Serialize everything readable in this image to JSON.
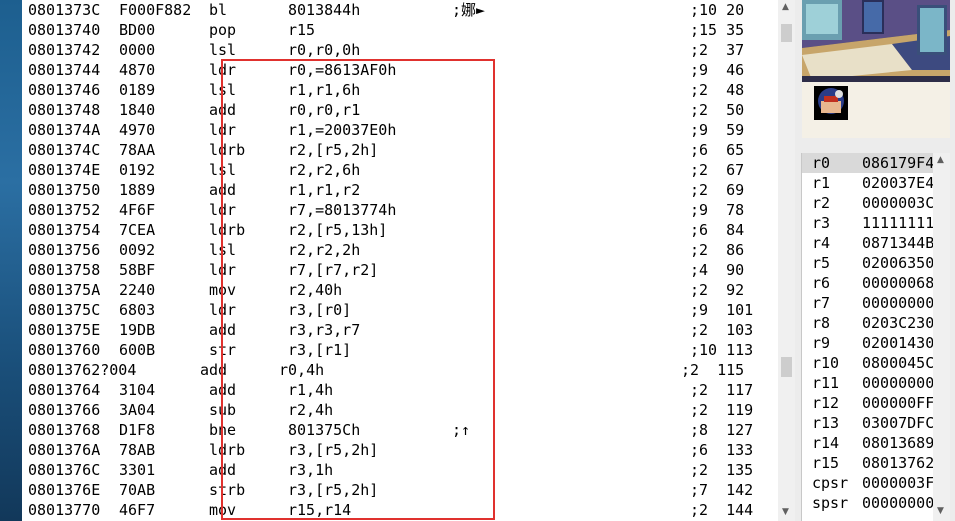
{
  "disassembly": {
    "rows": [
      {
        "addr": "0801373C",
        "op": "F000F882",
        "mn": "bl",
        "args": "8013844h",
        "cmt": ";娜►",
        "cyc": ";10 20"
      },
      {
        "addr": "08013740",
        "op": "BD00",
        "mn": "pop",
        "args": "r15",
        "cmt": "",
        "cyc": ";15 35"
      },
      {
        "addr": "08013742",
        "op": "0000",
        "mn": "lsl",
        "args": "r0,r0,0h",
        "cmt": "",
        "cyc": ";2  37"
      },
      {
        "addr": "08013744",
        "op": "4870",
        "mn": "ldr",
        "args": "r0,=8613AF0h",
        "cmt": "",
        "cyc": ";9  46"
      },
      {
        "addr": "08013746",
        "op": "0189",
        "mn": "lsl",
        "args": "r1,r1,6h",
        "cmt": "",
        "cyc": ";2  48"
      },
      {
        "addr": "08013748",
        "op": "1840",
        "mn": "add",
        "args": "r0,r0,r1",
        "cmt": "",
        "cyc": ";2  50"
      },
      {
        "addr": "0801374A",
        "op": "4970",
        "mn": "ldr",
        "args": "r1,=20037E0h",
        "cmt": "",
        "cyc": ";9  59"
      },
      {
        "addr": "0801374C",
        "op": "78AA",
        "mn": "ldrb",
        "args": "r2,[r5,2h]",
        "cmt": "",
        "cyc": ";6  65"
      },
      {
        "addr": "0801374E",
        "op": "0192",
        "mn": "lsl",
        "args": "r2,r2,6h",
        "cmt": "",
        "cyc": ";2  67"
      },
      {
        "addr": "08013750",
        "op": "1889",
        "mn": "add",
        "args": "r1,r1,r2",
        "cmt": "",
        "cyc": ";2  69"
      },
      {
        "addr": "08013752",
        "op": "4F6F",
        "mn": "ldr",
        "args": "r7,=8013774h",
        "cmt": "",
        "cyc": ";9  78"
      },
      {
        "addr": "08013754",
        "op": "7CEA",
        "mn": "ldrb",
        "args": "r2,[r5,13h]",
        "cmt": "",
        "cyc": ";6  84"
      },
      {
        "addr": "08013756",
        "op": "0092",
        "mn": "lsl",
        "args": "r2,r2,2h",
        "cmt": "",
        "cyc": ";2  86"
      },
      {
        "addr": "08013758",
        "op": "58BF",
        "mn": "ldr",
        "args": "r7,[r7,r2]",
        "cmt": "",
        "cyc": ";4  90"
      },
      {
        "addr": "0801375A",
        "op": "2240",
        "mn": "mov",
        "args": "r2,40h",
        "cmt": "",
        "cyc": ";2  92"
      },
      {
        "addr": "0801375C",
        "op": "6803",
        "mn": "ldr",
        "args": "r3,[r0]",
        "cmt": "",
        "cyc": ";9  101"
      },
      {
        "addr": "0801375E",
        "op": "19DB",
        "mn": "add",
        "args": "r3,r3,r7",
        "cmt": "",
        "cyc": ";2  103"
      },
      {
        "addr": "08013760",
        "op": "600B",
        "mn": "str",
        "args": "r3,[r1]",
        "cmt": "",
        "cyc": ";10 113"
      },
      {
        "addr": "08013762?004",
        "op": "",
        "mn": "add",
        "args": "r0,4h",
        "cmt": "",
        "cyc": ";2  115",
        "shift": true
      },
      {
        "addr": "08013764",
        "op": "3104",
        "mn": "add",
        "args": "r1,4h",
        "cmt": "",
        "cyc": ";2  117"
      },
      {
        "addr": "08013766",
        "op": "3A04",
        "mn": "sub",
        "args": "r2,4h",
        "cmt": "",
        "cyc": ";2  119"
      },
      {
        "addr": "08013768",
        "op": "D1F8",
        "mn": "bne",
        "args": "801375Ch",
        "cmt": ";↑",
        "cyc": ";8  127"
      },
      {
        "addr": "0801376A",
        "op": "78AB",
        "mn": "ldrb",
        "args": "r3,[r5,2h]",
        "cmt": "",
        "cyc": ";6  133"
      },
      {
        "addr": "0801376C",
        "op": "3301",
        "mn": "add",
        "args": "r3,1h",
        "cmt": "",
        "cyc": ";2  135"
      },
      {
        "addr": "0801376E",
        "op": "70AB",
        "mn": "strb",
        "args": "r3,[r5,2h]",
        "cmt": "",
        "cyc": ";7  142"
      },
      {
        "addr": "08013770",
        "op": "46F7",
        "mn": "mov",
        "args": "r15,r14",
        "cmt": "",
        "cyc": ";2  144"
      }
    ]
  },
  "registers": [
    {
      "name": "r0",
      "value": "086179F4",
      "selected": true
    },
    {
      "name": "r1",
      "value": "020037E4"
    },
    {
      "name": "r2",
      "value": "0000003C"
    },
    {
      "name": "r3",
      "value": "11111111"
    },
    {
      "name": "r4",
      "value": "0871344B"
    },
    {
      "name": "r5",
      "value": "02006350"
    },
    {
      "name": "r6",
      "value": "00000068"
    },
    {
      "name": "r7",
      "value": "00000000"
    },
    {
      "name": "r8",
      "value": "0203C230"
    },
    {
      "name": "r9",
      "value": "02001430"
    },
    {
      "name": "r10",
      "value": "0800045C"
    },
    {
      "name": "r11",
      "value": "00000000"
    },
    {
      "name": "r12",
      "value": "000000FF"
    },
    {
      "name": "r13",
      "value": "03007DFC"
    },
    {
      "name": "r14",
      "value": "08013689"
    },
    {
      "name": "r15",
      "value": "08013762"
    },
    {
      "name": "cpsr",
      "value": "0000003F"
    },
    {
      "name": "spsr",
      "value": "00000000"
    }
  ],
  "scrollbars": {
    "up_icon": "▲",
    "down_icon": "▼"
  },
  "colors": {
    "highlight_border": "#e0312e",
    "selected_register": "#d9d9d9"
  }
}
